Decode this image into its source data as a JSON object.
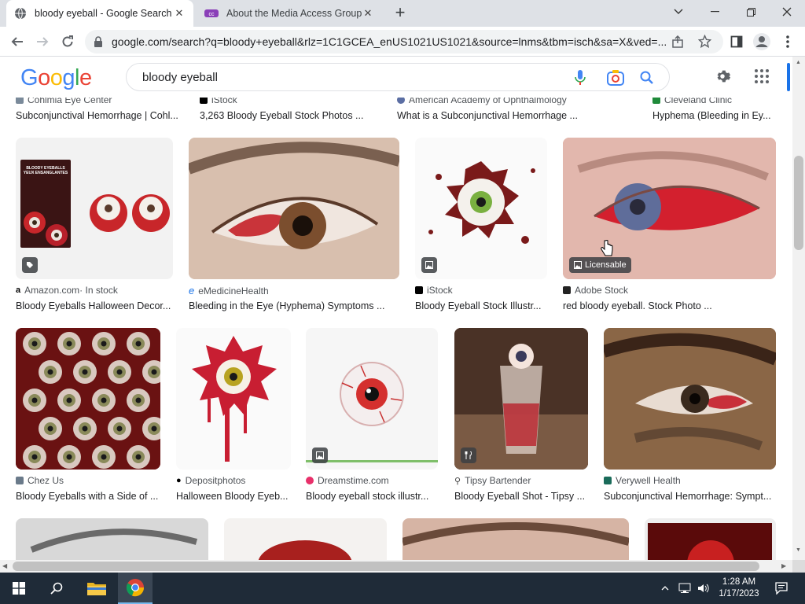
{
  "browser": {
    "tabs": [
      {
        "title": "bloody eyeball - Google Search",
        "close": "✕"
      },
      {
        "title": "About the Media Access Group at",
        "close": "✕"
      }
    ],
    "new_tab": "+",
    "url": "google.com/search?q=bloody+eyeball&rlz=1C1GCEA_enUS1021US1021&source=lnms&tbm=isch&sa=X&ved=..."
  },
  "google": {
    "logo": [
      "G",
      "o",
      "o",
      "g",
      "l",
      "e"
    ],
    "query": "bloody eyeball"
  },
  "top_row": [
    {
      "source": "Cohlmia Eye Center",
      "title": "Subconjunctival Hemorrhage | Cohl..."
    },
    {
      "source": "iStock",
      "title": "3,263 Bloody Eyeball Stock Photos ..."
    },
    {
      "source": "American Academy of Ophthalmology",
      "title": "What is a Subconjunctival Hemorrhage ..."
    },
    {
      "source": "Cleveland Clinic",
      "title": "Hyphema (Bleeding in Ey..."
    }
  ],
  "row1": [
    {
      "source": "Amazon.com",
      "stock": " · In stock",
      "title": "Bloody Eyeballs Halloween Decor..."
    },
    {
      "source": "eMedicineHealth",
      "title": "Bleeding in the Eye (Hyphema) Symptoms ..."
    },
    {
      "source": "iStock",
      "title": "Bloody Eyeball Stock Illustr..."
    },
    {
      "source": "Adobe Stock",
      "title": "red bloody eyeball. Stock Photo ...",
      "badge": "Licensable"
    }
  ],
  "row2": [
    {
      "source": "Chez Us",
      "title": "Bloody Eyeballs with a Side of ..."
    },
    {
      "source": "Depositphotos",
      "title": "Halloween Bloody Eyeb..."
    },
    {
      "source": "Dreamstime.com",
      "title": "Bloody eyeball stock illustr..."
    },
    {
      "source": "Tipsy Bartender",
      "title": "Bloody Eyeball Shot - Tipsy ..."
    },
    {
      "source": "Verywell Health",
      "title": "Subconjunctival Hemorrhage: Sympt..."
    }
  ],
  "package_text": {
    "line1": "BLOODY EYEBALLS",
    "line2": "YEUX ENSANGLANTES"
  },
  "taskbar": {
    "time": "1:28 AM",
    "date": "1/17/2023"
  }
}
